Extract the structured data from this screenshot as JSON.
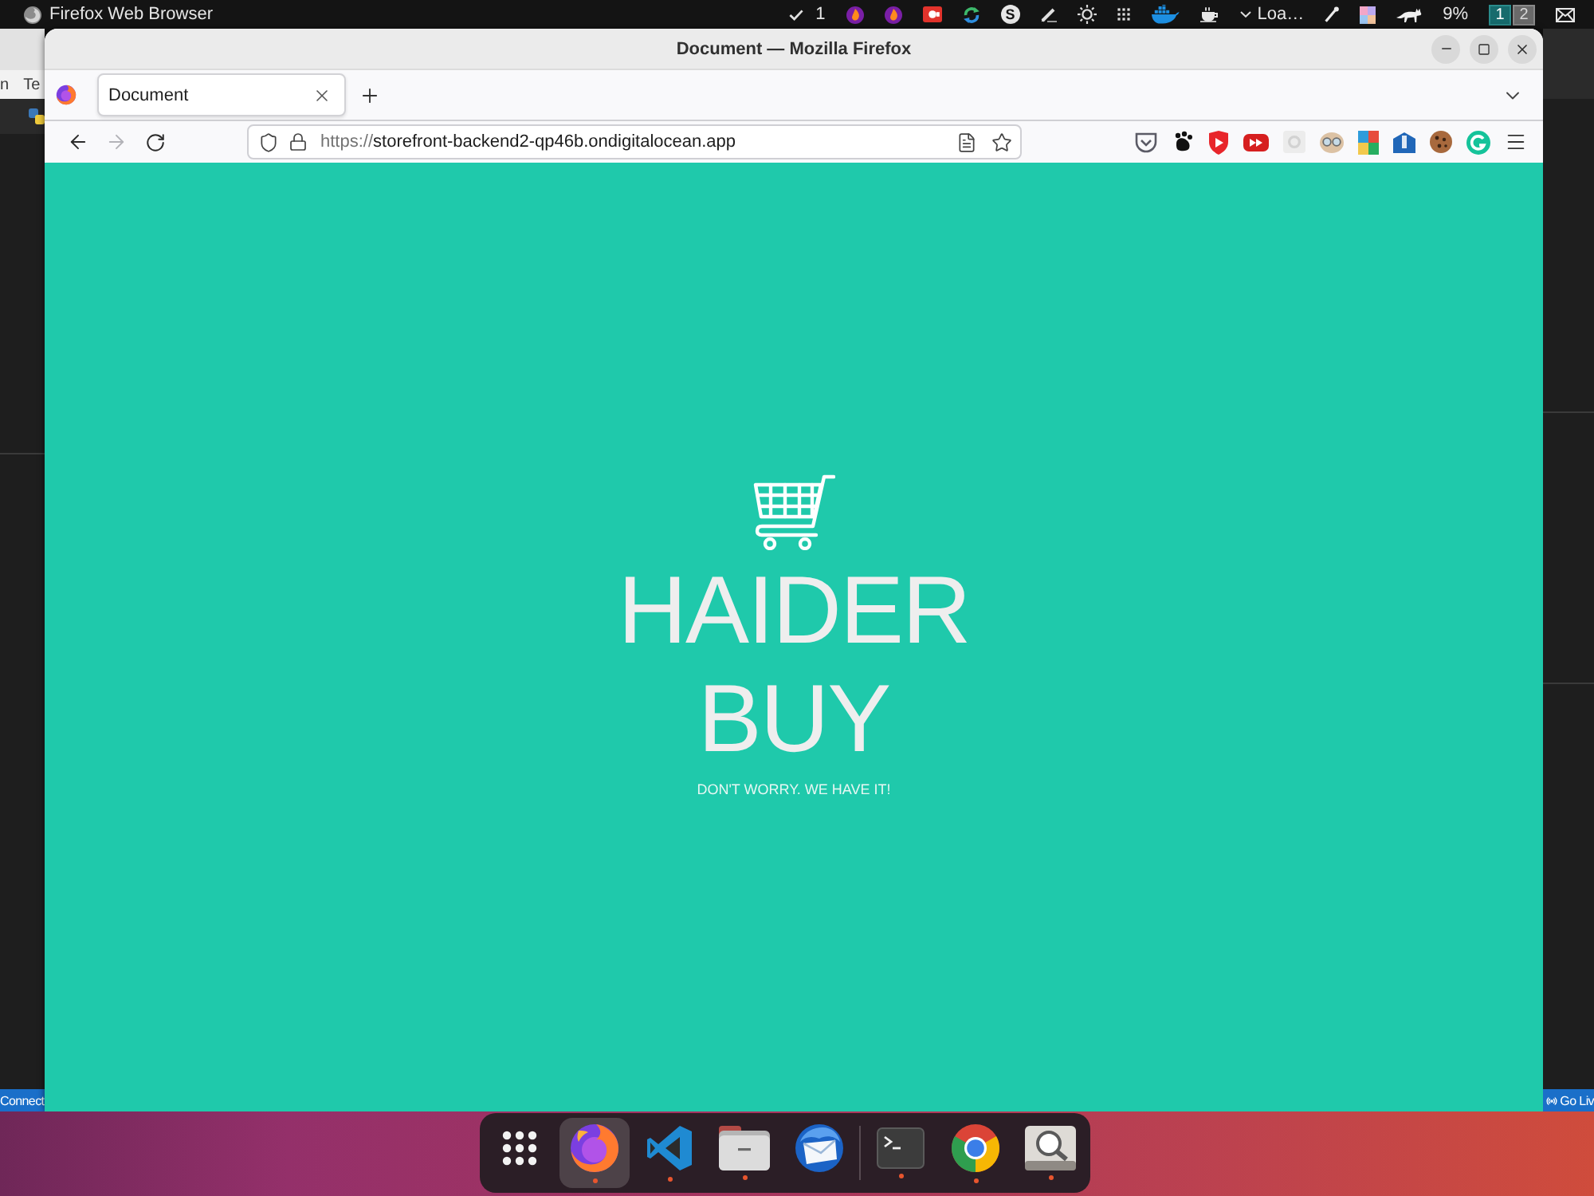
{
  "top_bar": {
    "app_name": "Firefox Web Browser",
    "tray": [
      {
        "kind": "check",
        "label": "1"
      },
      {
        "kind": "flame"
      },
      {
        "kind": "flame"
      },
      {
        "kind": "record"
      },
      {
        "kind": "sync"
      },
      {
        "kind": "letter",
        "label": "S"
      },
      {
        "kind": "pen"
      },
      {
        "kind": "sun"
      },
      {
        "kind": "dots"
      },
      {
        "kind": "whale"
      },
      {
        "kind": "cup"
      },
      {
        "kind": "dropdown",
        "label": "Loa…"
      },
      {
        "kind": "dropper"
      },
      {
        "kind": "palette"
      },
      {
        "kind": "cat"
      },
      {
        "kind": "text",
        "label": "9%"
      }
    ],
    "workspaces": [
      {
        "label": "1",
        "selected": true
      },
      {
        "label": "2",
        "selected": false
      }
    ]
  },
  "background_window": {
    "menu": [
      "n",
      "Te"
    ],
    "status_left": "Connect",
    "status_right": "Go Liv"
  },
  "browser": {
    "title": "Document — Mozilla Firefox",
    "tabs": [
      {
        "label": "Document",
        "selected": true
      }
    ],
    "forward_disabled": true,
    "url": {
      "scheme": "https://",
      "address": "storefront-backend2-qp46b.ondigitalocean.app"
    }
  },
  "page": {
    "heading": "HAIDER BUY",
    "tagline": "DON'T WORRY. WE HAVE IT!"
  },
  "dock": {
    "favorites": [
      {
        "kind": "grid",
        "running": false,
        "selected": false
      },
      {
        "kind": "fox",
        "running": true,
        "selected": true
      },
      {
        "kind": "code",
        "running": true,
        "selected": false
      },
      {
        "kind": "folder",
        "running": true,
        "selected": false
      },
      {
        "kind": "mail",
        "running": false,
        "selected": false
      }
    ],
    "others": [
      {
        "kind": "terminal",
        "running": true,
        "selected": false
      },
      {
        "kind": "ring",
        "running": true,
        "selected": false
      },
      {
        "kind": "magnifier",
        "running": true,
        "selected": false
      }
    ]
  }
}
